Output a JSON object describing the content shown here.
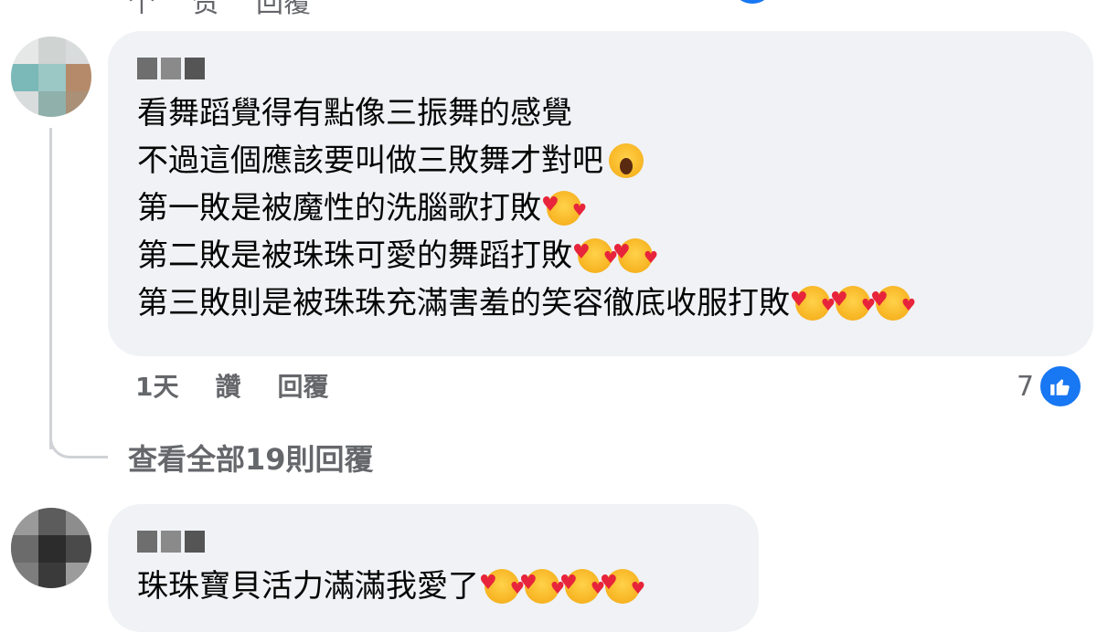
{
  "top_row": [
    "个",
    "赞",
    "回覆"
  ],
  "comment1": {
    "lines": [
      {
        "text": "看舞蹈覺得有點像三振舞的感覺",
        "emojis": []
      },
      {
        "text": "不過這個應該要叫做三敗舞才對吧",
        "emojis": [
          "face-scream-emoji"
        ]
      },
      {
        "text": "第一敗是被魔性的洗腦歌打敗",
        "emojis": [
          "smiling-face-with-hearts-emoji"
        ]
      },
      {
        "text": "第二敗是被珠珠可愛的舞蹈打敗",
        "emojis": [
          "smiling-face-with-hearts-emoji",
          "smiling-face-with-hearts-emoji"
        ]
      },
      {
        "text": "第三敗則是被珠珠充滿害羞的笑容徹底收服打敗",
        "emojis": [
          "smiling-face-with-hearts-emoji",
          "smiling-face-with-hearts-emoji",
          "smiling-face-with-hearts-emoji"
        ]
      }
    ],
    "time": "1天",
    "like_label": "讚",
    "reply_label": "回覆",
    "reaction_count": "7"
  },
  "view_replies": "查看全部19則回覆",
  "comment2": {
    "lines": [
      {
        "text": "珠珠寶貝活力滿滿我愛了",
        "emojis": [
          "smiling-face-with-hearts-emoji",
          "smiling-face-with-hearts-emoji",
          "smiling-face-with-hearts-emoji",
          "smiling-face-with-hearts-emoji"
        ]
      }
    ]
  },
  "colors": {
    "bubble": "#f0f2f5",
    "secondary_text": "#65676b",
    "like_blue": "#1877f2"
  }
}
